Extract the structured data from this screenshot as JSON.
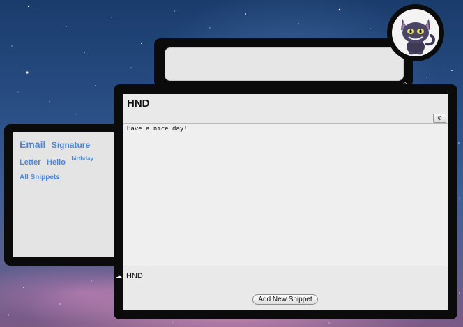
{
  "tags": {
    "items": [
      {
        "label": "Email",
        "size": "big"
      },
      {
        "label": "Signature",
        "size": "mid"
      },
      {
        "label": "Letter",
        "size": "med"
      },
      {
        "label": "Hello",
        "size": "med"
      },
      {
        "label": "birthday",
        "size": "sup"
      }
    ],
    "all_snippets": "All Snippets"
  },
  "search": {
    "placeholder": ""
  },
  "snippet": {
    "title": "HND",
    "body": "Have a nice day!",
    "name_value": "HND",
    "add_button": "Add New Snippet"
  },
  "icons": {
    "settings": "gear-icon",
    "avatar": "cat-avatar-icon",
    "resize": "resize-handle-icon",
    "cloud": "cloud-icon"
  },
  "colors": {
    "tag_link": "#4f86d8",
    "window_frame": "#0b0b0b",
    "panel": "#e9e9e9"
  }
}
